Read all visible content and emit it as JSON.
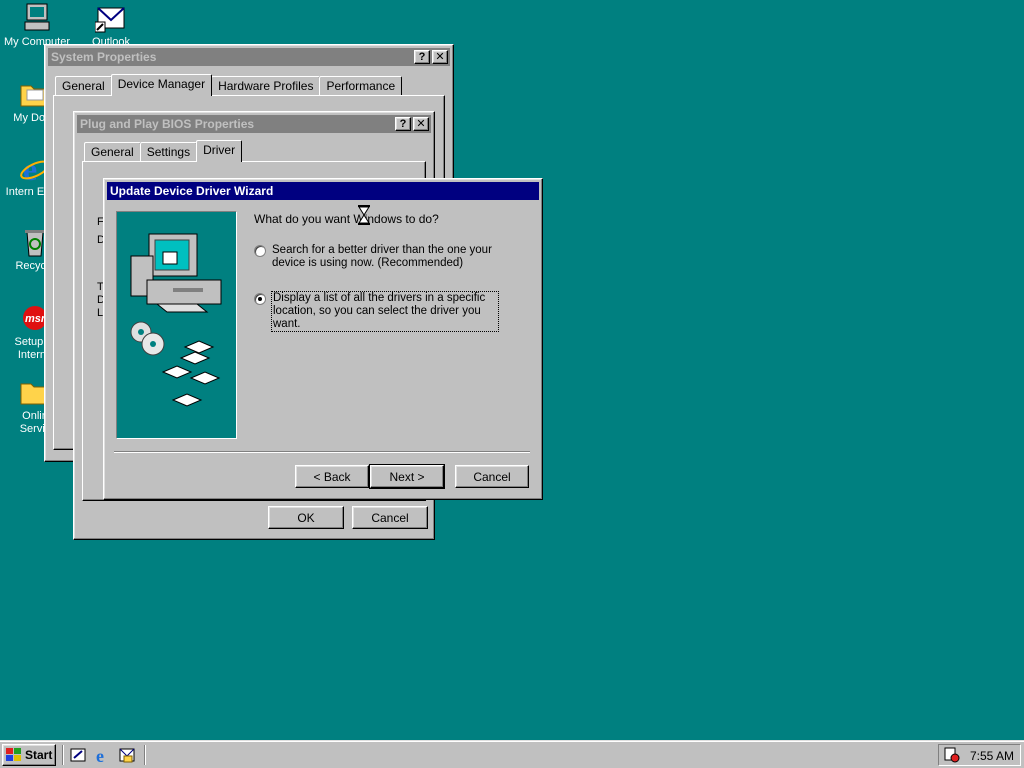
{
  "desktop": {
    "icons": [
      {
        "label": "My Computer",
        "icon": "computer-icon"
      },
      {
        "label": "Outlook",
        "icon": "outlook-icon"
      },
      {
        "label": "My Docu",
        "icon": "folder-icon"
      },
      {
        "label": "Intern Explo",
        "icon": "ie-icon"
      },
      {
        "label": "Recycle",
        "icon": "recycle-bin-icon"
      },
      {
        "label": "Setup M Interne",
        "icon": "msn-icon"
      },
      {
        "label": "Onlin Servic",
        "icon": "folder-icon"
      }
    ]
  },
  "system_properties": {
    "title": "System Properties",
    "tabs": [
      "General",
      "Device Manager",
      "Hardware Profiles",
      "Performance"
    ]
  },
  "bios_properties": {
    "title": "Plug and Play BIOS Properties",
    "tabs": [
      "General",
      "Settings",
      "Driver"
    ],
    "ok_label": "OK",
    "cancel_label": "Cancel",
    "partial_letters": [
      "F",
      "D",
      "T",
      "D",
      "L"
    ]
  },
  "wizard": {
    "title": "Update Device Driver Wizard",
    "question": "What do you want Windows to do?",
    "options": [
      {
        "label": "Search for a better driver than the one your device is using now. (Recommended)",
        "selected": false
      },
      {
        "label": "Display a list of all the drivers in a specific location, so you can select the driver you want.",
        "selected": true
      }
    ],
    "back_label": "< Back",
    "next_label": "Next >",
    "cancel_label": "Cancel"
  },
  "help_glyph": "?",
  "close_glyph": "✕",
  "taskbar": {
    "start_label": "Start",
    "clock": "7:55 AM"
  },
  "colors": {
    "desktop": "#008080",
    "active_title": "#000080",
    "inactive_title": "#808080",
    "face": "#c0c0c0"
  }
}
